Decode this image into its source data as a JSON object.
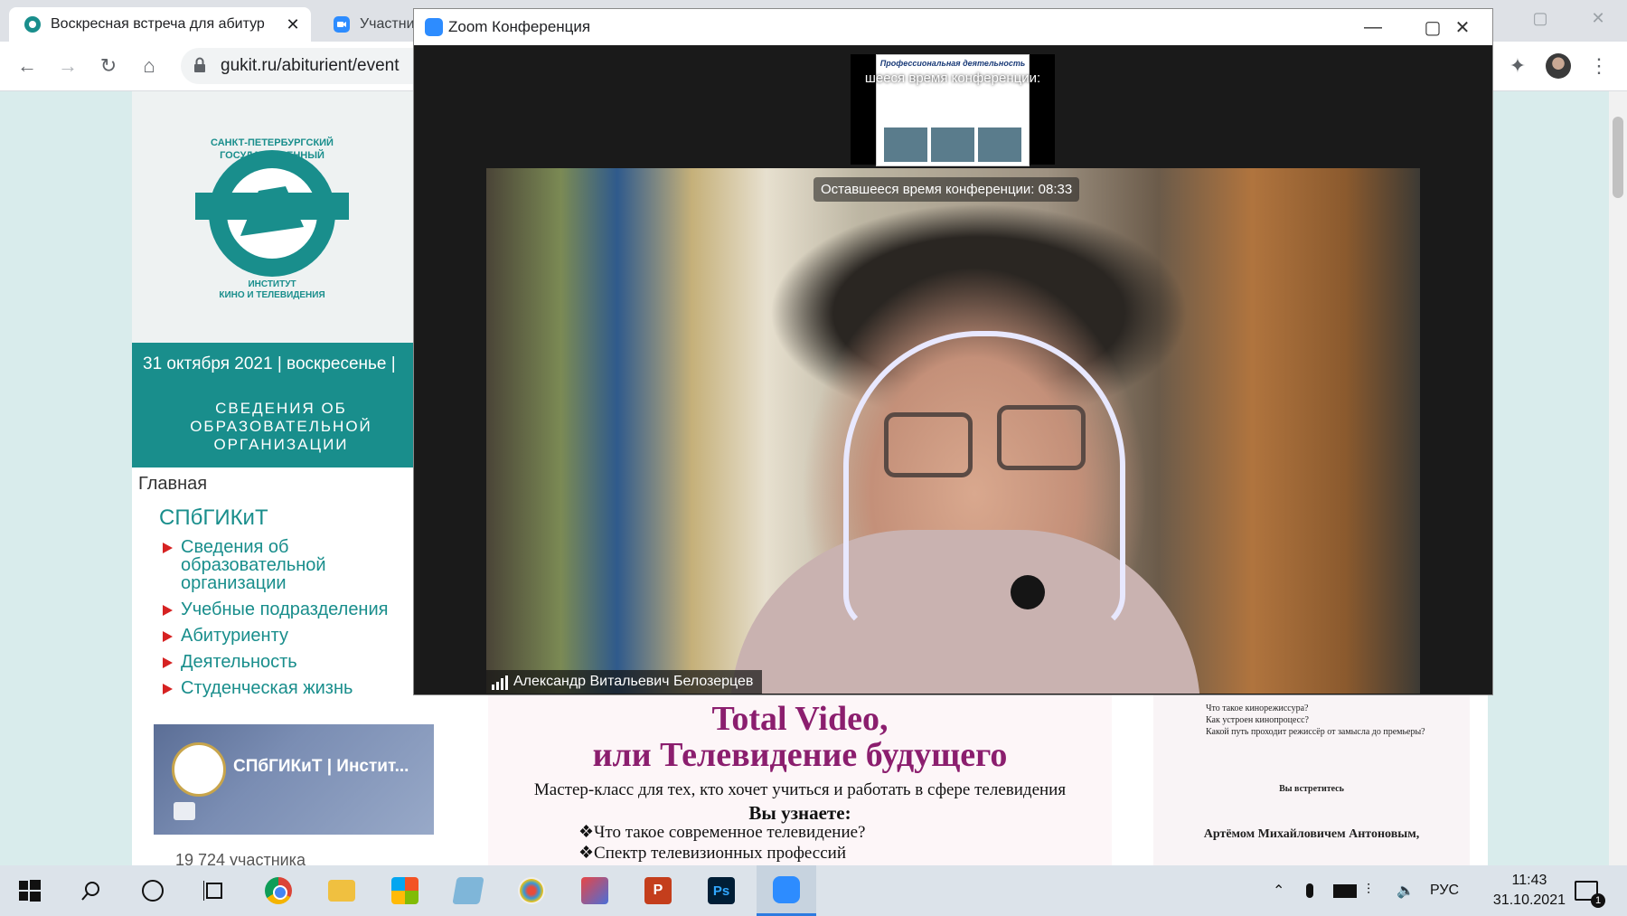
{
  "browser": {
    "tabs": [
      {
        "title": "Воскресная встреча для абитур",
        "close": "✕"
      },
      {
        "title": "Участни"
      }
    ],
    "url": "gukit.ru/abiturient/event",
    "window_controls": [
      "—",
      "▢",
      "✕"
    ]
  },
  "site": {
    "logo_text": [
      "САНКТ-ПЕТЕРБУРГСКИЙ",
      "ГОСУДАРСТВЕННЫЙ",
      "ИНСТИТУТ",
      "КИНО И ТЕЛЕВИДЕНИЯ"
    ],
    "date_line": "31 октября 2021 | воскресенье |",
    "info_band": [
      "СВЕДЕНИЯ ОБ",
      "ОБРАЗОВАТЕЛЬНОЙ",
      "ОРГАНИЗАЦИИ"
    ],
    "breadcrumb": "Главная",
    "section_title": "СПбГИКиТ",
    "menu": [
      "Сведения об образовательной организации",
      "Учебные подразделения",
      "Абитуриенту",
      "Деятельность",
      "Студенческая жизнь"
    ],
    "vk_card": {
      "name": "СПбГИКиТ | Инстит...",
      "members": "19 724 участника"
    },
    "poster": {
      "title_line1": "Total Video,",
      "title_line2": "или Телевидение будущего",
      "subtitle": "Мастер-класс для тех, кто хочет учиться и работать в сфере телевидения",
      "learn": "Вы узнаете:",
      "items": [
        "Что такое современное телевидение?",
        "Спектр телевизионных профессий"
      ]
    },
    "poster2": {
      "items": [
        "Что такое кинорежиссура?",
        "Как устроен кинопроцесс?",
        "Какой путь проходит режиссёр от замысла до премьеры?"
      ],
      "meet": "Вы встретитесь",
      "name": "Артёмом Михайловичем Антоновым,"
    }
  },
  "zoom": {
    "title": "Zoom Конференция",
    "thumb_slide_title": "Профессиональная деятельность",
    "thumb_timer": "шееся время конференции:",
    "timer": "Оставшееся время конференции: 08:33",
    "participant": "Александр Витальевич Белозерцев"
  },
  "taskbar": {
    "lang": "РУС",
    "time": "11:43",
    "date": "31.10.2021",
    "notifications": "1"
  }
}
